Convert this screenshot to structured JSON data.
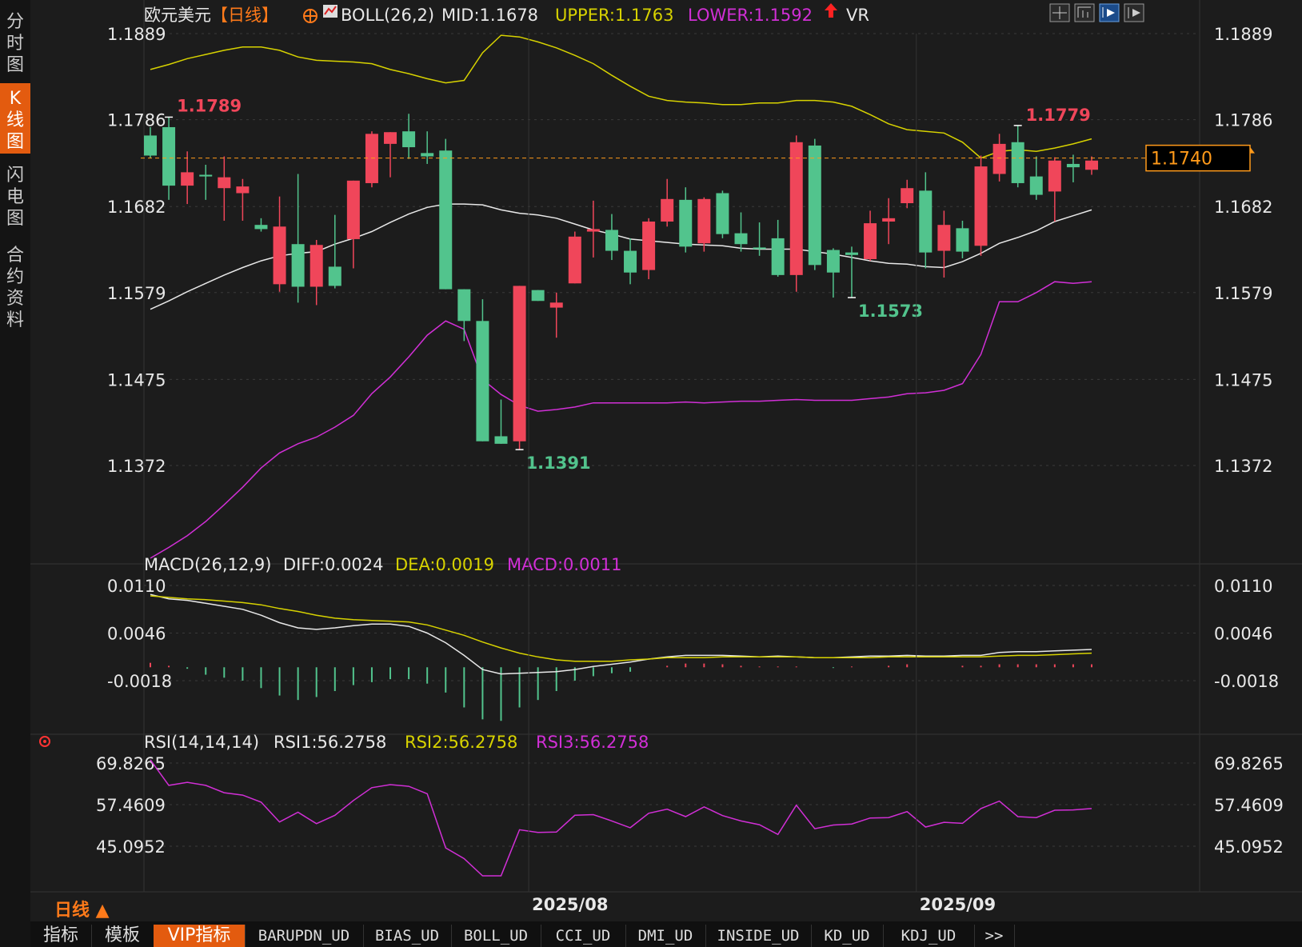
{
  "sidebar": {
    "tabs": [
      {
        "label": "分\n时\n图",
        "active": false
      },
      {
        "label": "K\n线\n图",
        "active": true
      },
      {
        "label": "闪\n电\n图",
        "active": false
      },
      {
        "label": "合\n约\n资\n料",
        "active": false
      }
    ]
  },
  "main": {
    "instrument": "欧元美元",
    "period_bracket": "【日线】",
    "boll_label": "BOLL(26,2)",
    "mid": "MID:1.1678",
    "upper": "UPPER:1.1763",
    "lower": "LOWER:1.1592",
    "vr_label": "VR",
    "price_ticks": [
      "1.1889",
      "1.1786",
      "1.1682",
      "1.1579",
      "1.1475",
      "1.1372"
    ],
    "annotations": {
      "high_left": "1.1789",
      "high_right": "1.1779",
      "low_mid": "1.1573",
      "low_min": "1.1391"
    },
    "last_price": "1.1740",
    "colors": {
      "up": "#f0465a",
      "down": "#52c48d",
      "upper": "#d7d200",
      "mid": "#e8e8e8",
      "lower": "#d12fd6",
      "dea": "#d7d200",
      "rsi": "#d12fd6",
      "accent": "#e35b0f"
    }
  },
  "macd": {
    "label": "MACD(26,12,9)",
    "diff": "DIFF:0.0024",
    "dea": "DEA:0.0019",
    "macd": "MACD:0.0011",
    "ticks": [
      "0.0110",
      "0.0046",
      "-0.0018"
    ]
  },
  "rsi": {
    "label": "RSI(14,14,14)",
    "rsi1": "RSI1:56.2758",
    "rsi2": "RSI2:56.2758",
    "rsi3": "RSI3:56.2758",
    "ticks": [
      "69.8265",
      "57.4609",
      "45.0952"
    ]
  },
  "x_axis": {
    "labels": [
      "2025/08",
      "2025/09"
    ]
  },
  "period_label": "日线 ▲",
  "bottom_tabs": [
    {
      "label": "指标",
      "active": false
    },
    {
      "label": "模板",
      "active": false
    },
    {
      "label": "VIP指标",
      "active": true
    },
    {
      "label": "BARUPDN_UD",
      "active": false
    },
    {
      "label": "BIAS_UD",
      "active": false
    },
    {
      "label": "BOLL_UD",
      "active": false
    },
    {
      "label": "CCI_UD",
      "active": false
    },
    {
      "label": "DMI_UD",
      "active": false
    },
    {
      "label": "INSIDE_UD",
      "active": false
    },
    {
      "label": "KD_UD",
      "active": false
    },
    {
      "label": "KDJ_UD",
      "active": false
    },
    {
      "label": ">>",
      "active": false
    }
  ],
  "chart_data": {
    "type": "candlestick",
    "candles": [
      {
        "o": 1.1767,
        "h": 1.1777,
        "c": 1.1743,
        "l": 1.174
      },
      {
        "o": 1.1777,
        "h": 1.1789,
        "c": 1.1707,
        "l": 1.169
      },
      {
        "o": 1.1707,
        "h": 1.1748,
        "c": 1.1723,
        "l": 1.1685
      },
      {
        "o": 1.172,
        "h": 1.1732,
        "c": 1.1718,
        "l": 1.169
      },
      {
        "o": 1.1704,
        "h": 1.1742,
        "c": 1.1717,
        "l": 1.1665
      },
      {
        "o": 1.1698,
        "h": 1.1715,
        "c": 1.1706,
        "l": 1.1665
      },
      {
        "o": 1.166,
        "h": 1.1668,
        "c": 1.1655,
        "l": 1.1652
      },
      {
        "o": 1.1589,
        "h": 1.1694,
        "c": 1.1658,
        "l": 1.158
      },
      {
        "o": 1.1637,
        "h": 1.1721,
        "c": 1.1586,
        "l": 1.1567
      },
      {
        "o": 1.1586,
        "h": 1.1642,
        "c": 1.1636,
        "l": 1.1564
      },
      {
        "o": 1.161,
        "h": 1.1672,
        "c": 1.1587,
        "l": 1.1584
      },
      {
        "o": 1.1643,
        "h": 1.1712,
        "c": 1.1713,
        "l": 1.1608
      },
      {
        "o": 1.171,
        "h": 1.1772,
        "c": 1.1769,
        "l": 1.1705
      },
      {
        "o": 1.1757,
        "h": 1.177,
        "c": 1.1771,
        "l": 1.1717
      },
      {
        "o": 1.1772,
        "h": 1.1793,
        "c": 1.1753,
        "l": 1.1739
      },
      {
        "o": 1.1746,
        "h": 1.1772,
        "c": 1.1742,
        "l": 1.1733
      },
      {
        "o": 1.1749,
        "h": 1.1763,
        "c": 1.1583,
        "l": 1.1583
      },
      {
        "o": 1.1583,
        "h": 1.1545,
        "c": 1.1545,
        "l": 1.1521
      },
      {
        "o": 1.1545,
        "h": 1.1571,
        "c": 1.1401,
        "l": 1.1401
      },
      {
        "o": 1.1407,
        "h": 1.1451,
        "c": 1.1398,
        "l": 1.1398
      },
      {
        "o": 1.1401,
        "h": 1.1587,
        "c": 1.1587,
        "l": 1.1391
      },
      {
        "o": 1.1582,
        "h": 1.1575,
        "c": 1.1569,
        "l": 1.157
      },
      {
        "o": 1.1561,
        "h": 1.1579,
        "c": 1.1567,
        "l": 1.1525
      },
      {
        "o": 1.159,
        "h": 1.1652,
        "c": 1.1646,
        "l": 1.159
      },
      {
        "o": 1.1652,
        "h": 1.1689,
        "c": 1.1655,
        "l": 1.1621
      },
      {
        "o": 1.1654,
        "h": 1.1673,
        "c": 1.1629,
        "l": 1.1618
      },
      {
        "o": 1.1629,
        "h": 1.1644,
        "c": 1.1603,
        "l": 1.1589
      },
      {
        "o": 1.1606,
        "h": 1.1668,
        "c": 1.1664,
        "l": 1.1595
      },
      {
        "o": 1.1664,
        "h": 1.1715,
        "c": 1.1691,
        "l": 1.1658
      },
      {
        "o": 1.169,
        "h": 1.1705,
        "c": 1.1634,
        "l": 1.1627
      },
      {
        "o": 1.1638,
        "h": 1.1693,
        "c": 1.1691,
        "l": 1.1628
      },
      {
        "o": 1.1698,
        "h": 1.1701,
        "c": 1.1649,
        "l": 1.1644
      },
      {
        "o": 1.165,
        "h": 1.1675,
        "c": 1.1637,
        "l": 1.1628
      },
      {
        "o": 1.1633,
        "h": 1.1663,
        "c": 1.1632,
        "l": 1.1623
      },
      {
        "o": 1.1644,
        "h": 1.1666,
        "c": 1.16,
        "l": 1.1598
      },
      {
        "o": 1.16,
        "h": 1.1767,
        "c": 1.1759,
        "l": 1.158
      },
      {
        "o": 1.1755,
        "h": 1.1763,
        "c": 1.1612,
        "l": 1.1606
      },
      {
        "o": 1.163,
        "h": 1.1632,
        "c": 1.1603,
        "l": 1.1573
      },
      {
        "o": 1.1627,
        "h": 1.1634,
        "c": 1.1624,
        "l": 1.1573
      },
      {
        "o": 1.1619,
        "h": 1.1677,
        "c": 1.1662,
        "l": 1.1617
      },
      {
        "o": 1.1664,
        "h": 1.1692,
        "c": 1.1668,
        "l": 1.1637
      },
      {
        "o": 1.1686,
        "h": 1.1714,
        "c": 1.1704,
        "l": 1.168
      },
      {
        "o": 1.1701,
        "h": 1.1723,
        "c": 1.1627,
        "l": 1.1608
      },
      {
        "o": 1.1629,
        "h": 1.1677,
        "c": 1.166,
        "l": 1.1597
      },
      {
        "o": 1.1656,
        "h": 1.1665,
        "c": 1.1628,
        "l": 1.162
      },
      {
        "o": 1.1635,
        "h": 1.1743,
        "c": 1.173,
        "l": 1.1623
      },
      {
        "o": 1.1721,
        "h": 1.1769,
        "c": 1.1757,
        "l": 1.1712
      },
      {
        "o": 1.1759,
        "h": 1.1779,
        "c": 1.171,
        "l": 1.1705
      },
      {
        "o": 1.1718,
        "h": 1.1742,
        "c": 1.1696,
        "l": 1.169
      },
      {
        "o": 1.17,
        "h": 1.1741,
        "c": 1.1737,
        "l": 1.1664
      },
      {
        "o": 1.1733,
        "h": 1.1744,
        "c": 1.1729,
        "l": 1.1711
      },
      {
        "o": 1.1726,
        "h": 1.1742,
        "c": 1.1737,
        "l": 1.172
      }
    ],
    "boll_upper": [
      1.1846,
      1.1852,
      1.1859,
      1.1864,
      1.1869,
      1.1873,
      1.1873,
      1.1869,
      1.1861,
      1.1857,
      1.1856,
      1.1855,
      1.1853,
      1.1846,
      1.1841,
      1.1835,
      1.183,
      1.1833,
      1.1866,
      1.1887,
      1.1885,
      1.1879,
      1.1872,
      1.1863,
      1.1853,
      1.1839,
      1.1826,
      1.1814,
      1.1809,
      1.1807,
      1.1806,
      1.1804,
      1.1804,
      1.1806,
      1.1806,
      1.1809,
      1.1809,
      1.1807,
      1.1802,
      1.1792,
      1.1781,
      1.1774,
      1.1772,
      1.177,
      1.1759,
      1.174,
      1.1748,
      1.175,
      1.1748,
      1.1752,
      1.1757,
      1.1763
    ],
    "boll_mid": [
      1.1559,
      1.1569,
      1.158,
      1.159,
      1.16,
      1.1609,
      1.1617,
      1.1623,
      1.1626,
      1.1628,
      1.1637,
      1.1644,
      1.1652,
      1.1663,
      1.1673,
      1.1681,
      1.1685,
      1.1685,
      1.1684,
      1.1678,
      1.1674,
      1.1672,
      1.1668,
      1.1661,
      1.1654,
      1.1649,
      1.1643,
      1.1641,
      1.1639,
      1.1637,
      1.1636,
      1.1635,
      1.1632,
      1.1631,
      1.1631,
      1.1631,
      1.1628,
      1.1625,
      1.1621,
      1.1617,
      1.1614,
      1.1613,
      1.161,
      1.1609,
      1.1616,
      1.1626,
      1.1638,
      1.1645,
      1.1653,
      1.1664,
      1.1671,
      1.1678
    ],
    "boll_lower": [
      1.1261,
      1.1274,
      1.1288,
      1.1305,
      1.1325,
      1.1346,
      1.1369,
      1.1387,
      1.1398,
      1.1406,
      1.1418,
      1.1432,
      1.1458,
      1.1478,
      1.1502,
      1.1528,
      1.1545,
      1.1535,
      1.1475,
      1.1457,
      1.1444,
      1.1437,
      1.1439,
      1.1442,
      1.1447,
      1.1447,
      1.1447,
      1.1447,
      1.1447,
      1.1448,
      1.1447,
      1.1448,
      1.1449,
      1.1449,
      1.145,
      1.1451,
      1.145,
      1.145,
      1.145,
      1.1452,
      1.1454,
      1.1458,
      1.1459,
      1.1462,
      1.147,
      1.1505,
      1.1568,
      1.1568,
      1.1579,
      1.1592,
      1.159,
      1.1592
    ],
    "macd_diff": [
      0.0098,
      0.0092,
      0.009,
      0.0086,
      0.0082,
      0.0078,
      0.007,
      0.006,
      0.0053,
      0.0051,
      0.0053,
      0.0056,
      0.0058,
      0.0058,
      0.0055,
      0.0046,
      0.0033,
      0.0016,
      -0.0003,
      -0.0009,
      -0.0008,
      -0.0007,
      -0.0006,
      -0.0003,
      0.0001,
      0.0004,
      0.0007,
      0.0011,
      0.0014,
      0.0016,
      0.0016,
      0.0016,
      0.0015,
      0.0014,
      0.0015,
      0.0014,
      0.0013,
      0.0013,
      0.0014,
      0.0015,
      0.0015,
      0.0016,
      0.0015,
      0.0015,
      0.0016,
      0.0016,
      0.002,
      0.0021,
      0.0021,
      0.0022,
      0.0023,
      0.0024
    ],
    "macd_dea": [
      0.0096,
      0.0094,
      0.0092,
      0.0091,
      0.0089,
      0.0087,
      0.0084,
      0.0079,
      0.0075,
      0.007,
      0.0066,
      0.0064,
      0.0063,
      0.0062,
      0.0061,
      0.0057,
      0.005,
      0.0043,
      0.0034,
      0.0026,
      0.0019,
      0.0014,
      0.001,
      0.0008,
      0.0008,
      0.0008,
      0.001,
      0.0011,
      0.0013,
      0.0013,
      0.0013,
      0.0014,
      0.0014,
      0.0014,
      0.0014,
      0.0014,
      0.0013,
      0.0013,
      0.0013,
      0.0013,
      0.0014,
      0.0014,
      0.0014,
      0.0014,
      0.0014,
      0.0014,
      0.0015,
      0.0016,
      0.0016,
      0.0017,
      0.0018,
      0.0019
    ],
    "macd_hist": [
      0.0006,
      0.0002,
      -0.0002,
      -0.001,
      -0.0014,
      -0.0018,
      -0.0028,
      -0.0038,
      -0.0044,
      -0.004,
      -0.0032,
      -0.0024,
      -0.002,
      -0.0016,
      -0.0016,
      -0.0022,
      -0.0034,
      -0.0054,
      -0.007,
      -0.0072,
      -0.0054,
      -0.0044,
      -0.0032,
      -0.0018,
      -0.0012,
      -0.0008,
      -0.0006,
      0.0,
      0.0002,
      0.0005,
      0.0005,
      0.0004,
      0.0002,
      0.0001,
      0.0001,
      0.0001,
      0.0,
      -0.0001,
      0.0001,
      0.0,
      0.0002,
      0.0004,
      0.0,
      0.0,
      0.0002,
      0.0002,
      0.0004,
      0.0004,
      0.0004,
      0.0004,
      0.0004,
      0.0004
    ],
    "rsi": [
      70.8,
      63.2,
      64.1,
      63.2,
      61.0,
      60.3,
      58.2,
      52.3,
      55.2,
      51.8,
      54.3,
      58.7,
      62.5,
      63.4,
      62.9,
      60.7,
      44.6,
      41.4,
      36.3,
      36.3,
      50.0,
      49.2,
      49.3,
      54.3,
      54.5,
      52.6,
      50.6,
      54.9,
      56.1,
      53.9,
      56.8,
      54.2,
      52.6,
      51.5,
      48.6,
      57.3,
      50.3,
      51.4,
      51.7,
      53.5,
      53.6,
      55.4,
      50.8,
      52.2,
      51.9,
      56.3,
      58.5,
      53.9,
      53.6,
      55.8,
      55.9,
      56.3
    ],
    "price_range": [
      1.125,
      1.192
    ],
    "macd_range": [
      -0.0077,
      0.0125
    ],
    "rsi_range": [
      30,
      76
    ]
  }
}
